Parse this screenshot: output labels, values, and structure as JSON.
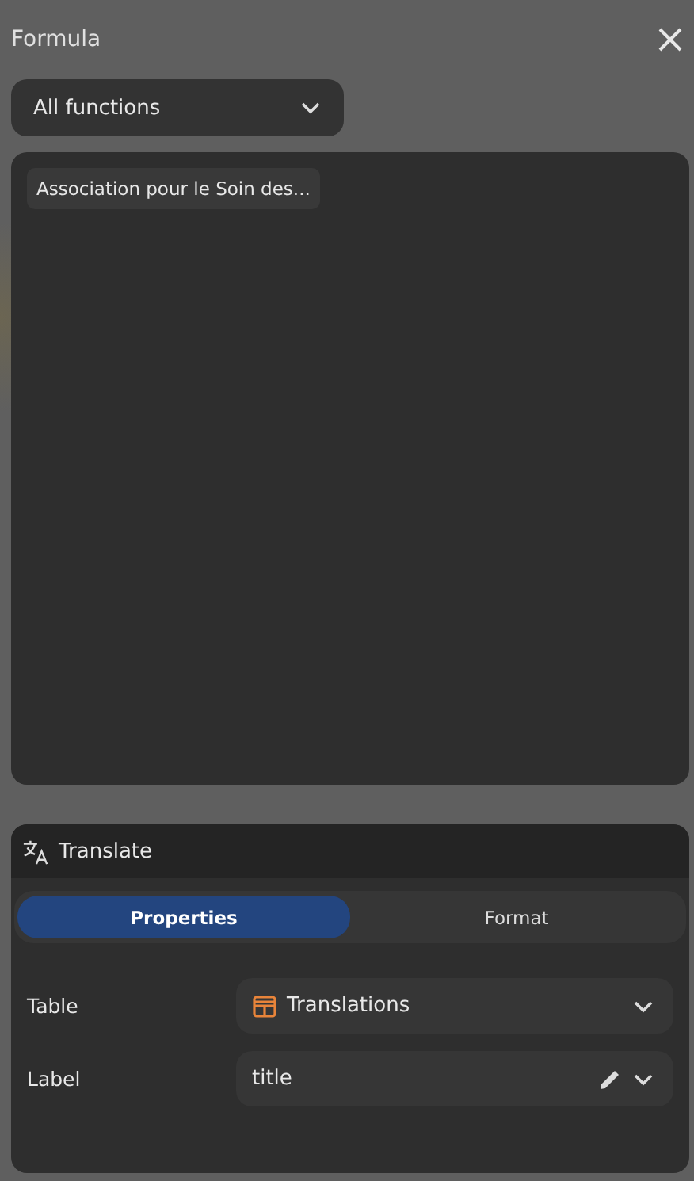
{
  "window": {
    "title": "Formula"
  },
  "function_filter": {
    "value": "All functions"
  },
  "editor": {
    "tokens": [
      {
        "text": "Association pour le Soin des..."
      }
    ]
  },
  "node": {
    "title": "Translate",
    "tabs": [
      {
        "label": "Properties",
        "selected": true
      },
      {
        "label": "Format",
        "selected": false
      }
    ],
    "fields": [
      {
        "label": "Table",
        "value": "Translations",
        "kind": "table",
        "editable": false
      },
      {
        "label": "Label",
        "value": "title",
        "kind": "text",
        "editable": true
      }
    ]
  }
}
